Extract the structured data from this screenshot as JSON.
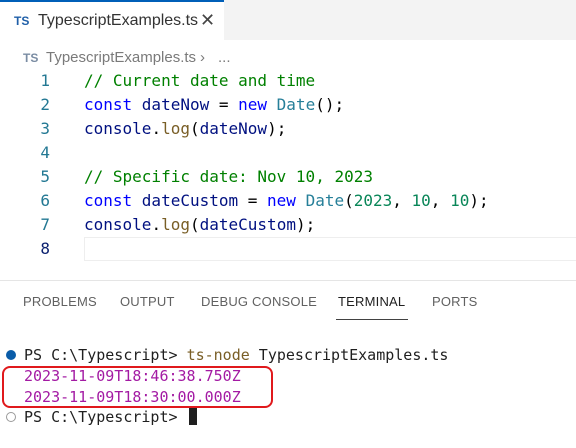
{
  "tab": {
    "icon": "TS",
    "title": "TypescriptExamples.ts",
    "close": "✕"
  },
  "breadcrumb": {
    "icon": "TS",
    "file": "TypescriptExamples.ts",
    "separator": "›",
    "more": "..."
  },
  "editor": {
    "lines": [
      {
        "num": "1",
        "tokens": [
          {
            "t": "// Current date and time",
            "c": "comment"
          }
        ]
      },
      {
        "num": "2",
        "tokens": [
          {
            "t": "const ",
            "c": "kw"
          },
          {
            "t": "dateNow",
            "c": "var"
          },
          {
            "t": " = ",
            "c": "punc"
          },
          {
            "t": "new ",
            "c": "kw"
          },
          {
            "t": "Date",
            "c": "type"
          },
          {
            "t": "();",
            "c": "punc"
          }
        ]
      },
      {
        "num": "3",
        "tokens": [
          {
            "t": "console",
            "c": "var"
          },
          {
            "t": ".",
            "c": "punc"
          },
          {
            "t": "log",
            "c": "fn"
          },
          {
            "t": "(",
            "c": "punc"
          },
          {
            "t": "dateNow",
            "c": "var"
          },
          {
            "t": ");",
            "c": "punc"
          }
        ]
      },
      {
        "num": "4",
        "tokens": []
      },
      {
        "num": "5",
        "tokens": [
          {
            "t": "// Specific date: Nov 10, 2023",
            "c": "comment"
          }
        ]
      },
      {
        "num": "6",
        "tokens": [
          {
            "t": "const ",
            "c": "kw"
          },
          {
            "t": "dateCustom",
            "c": "var"
          },
          {
            "t": " = ",
            "c": "punc"
          },
          {
            "t": "new ",
            "c": "kw"
          },
          {
            "t": "Date",
            "c": "type"
          },
          {
            "t": "(",
            "c": "punc"
          },
          {
            "t": "2023",
            "c": "num"
          },
          {
            "t": ", ",
            "c": "punc"
          },
          {
            "t": "10",
            "c": "num"
          },
          {
            "t": ", ",
            "c": "punc"
          },
          {
            "t": "10",
            "c": "num"
          },
          {
            "t": ");",
            "c": "punc"
          }
        ]
      },
      {
        "num": "7",
        "tokens": [
          {
            "t": "console",
            "c": "var"
          },
          {
            "t": ".",
            "c": "punc"
          },
          {
            "t": "log",
            "c": "fn"
          },
          {
            "t": "(",
            "c": "punc"
          },
          {
            "t": "dateCustom",
            "c": "var"
          },
          {
            "t": ");",
            "c": "punc"
          }
        ]
      },
      {
        "num": "8",
        "tokens": []
      }
    ]
  },
  "panel": {
    "tabs": [
      {
        "label": "PROBLEMS",
        "active": false
      },
      {
        "label": "OUTPUT",
        "active": false
      },
      {
        "label": "DEBUG CONSOLE",
        "active": false
      },
      {
        "label": "TERMINAL",
        "active": true
      },
      {
        "label": "PORTS",
        "active": false
      }
    ]
  },
  "terminal": {
    "prompt1": "PS C:\\Typescript> ",
    "command": "ts-node",
    "arg": " TypescriptExamples.ts",
    "output": [
      "2023-11-09T18:46:38.750Z",
      "2023-11-09T18:30:00.000Z"
    ],
    "prompt2": "PS C:\\Typescript> "
  },
  "colors": {
    "accent": "#005fb8",
    "highlight_border": "#e0191c",
    "output_text": "#a31aa3"
  }
}
